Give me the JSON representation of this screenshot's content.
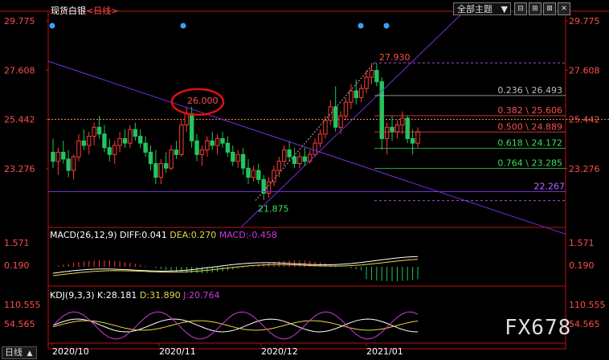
{
  "header": {
    "title": "现货白银",
    "period_label": "<日线>",
    "theme_label": "全部主题",
    "theme_arrow": "▼"
  },
  "toolbar": {
    "btn1": "⊟",
    "btn2": "⊞",
    "btn3": "⊠",
    "btn4": "✕"
  },
  "period_button": {
    "label": "日线",
    "arrow": "▲"
  },
  "watermark": "FX678",
  "macd": {
    "label": "MACD(26,12,9)",
    "diff": "DIFF:0.041",
    "dea": "DEA:0.270",
    "macd": "MACD:-0.458"
  },
  "kdj": {
    "label": "KDJ(9,3,3)",
    "k": "K:28.181",
    "d": "D:31.890",
    "j": "J:20.764"
  },
  "colors": {
    "up": "#ff3b3b",
    "down": "#22c55e",
    "axis": "#c01010",
    "trend": "#7b2cd6",
    "fib": "#9a9a9a",
    "dash_ref": "#ff6060"
  },
  "chart_data": [
    {
      "type": "candlestick",
      "title": "现货白银 <日线>",
      "y_ticks": [
        "29.775",
        "27.608",
        "25.442",
        "23.276"
      ],
      "ylim": [
        20.8,
        30.2
      ],
      "x_ticks": [
        "2020/10",
        "2020/11",
        "2020/12",
        "2021/01"
      ],
      "annotations": {
        "high_1": "26.000",
        "low": "21.875",
        "high_2": "27.930",
        "trendline_label": "22.267"
      },
      "fibonacci": [
        {
          "ratio": "0.236",
          "value": "26.493",
          "label": "0.236 \\ 26.493"
        },
        {
          "ratio": "0.382",
          "value": "25.606",
          "label": "0.382 \\ 25.606"
        },
        {
          "ratio": "0.500",
          "value": "24.889",
          "label": "0.500 \\ 24.889"
        },
        {
          "ratio": "0.618",
          "value": "24.172",
          "label": "0.618 \\ 24.172"
        },
        {
          "ratio": "0.764",
          "value": "23.285",
          "label": "0.764 \\ 23.285"
        }
      ],
      "ohlc": [
        [
          24.0,
          24.6,
          23.3,
          23.6
        ],
        [
          23.6,
          24.2,
          23.0,
          24.0
        ],
        [
          24.0,
          24.5,
          23.5,
          23.7
        ],
        [
          23.7,
          24.1,
          22.9,
          23.2
        ],
        [
          23.2,
          23.9,
          22.8,
          23.8
        ],
        [
          23.8,
          24.8,
          23.6,
          24.5
        ],
        [
          24.5,
          25.0,
          24.1,
          24.3
        ],
        [
          24.3,
          24.9,
          23.9,
          24.7
        ],
        [
          24.7,
          25.3,
          24.3,
          25.1
        ],
        [
          25.1,
          25.6,
          24.6,
          24.8
        ],
        [
          24.8,
          25.2,
          24.0,
          24.2
        ],
        [
          24.2,
          24.6,
          23.6,
          23.9
        ],
        [
          23.9,
          24.5,
          23.5,
          24.3
        ],
        [
          24.3,
          24.9,
          24.0,
          24.6
        ],
        [
          24.6,
          25.0,
          24.2,
          24.4
        ],
        [
          24.4,
          25.2,
          24.2,
          25.0
        ],
        [
          25.0,
          25.3,
          24.5,
          24.7
        ],
        [
          24.7,
          25.0,
          24.2,
          24.4
        ],
        [
          24.4,
          24.7,
          23.8,
          24.0
        ],
        [
          24.0,
          24.3,
          23.2,
          23.5
        ],
        [
          23.5,
          24.1,
          22.6,
          22.9
        ],
        [
          22.9,
          23.7,
          22.6,
          23.5
        ],
        [
          23.5,
          24.0,
          23.1,
          23.3
        ],
        [
          23.3,
          24.3,
          23.2,
          24.1
        ],
        [
          24.1,
          24.5,
          23.7,
          23.9
        ],
        [
          23.9,
          25.4,
          23.8,
          25.2
        ],
        [
          25.2,
          26.0,
          24.9,
          25.7
        ],
        [
          25.7,
          26.0,
          24.2,
          24.5
        ],
        [
          24.5,
          24.8,
          23.6,
          23.9
        ],
        [
          23.9,
          24.3,
          23.4,
          24.1
        ],
        [
          24.1,
          24.7,
          23.8,
          24.5
        ],
        [
          24.5,
          24.9,
          24.1,
          24.3
        ],
        [
          24.3,
          24.8,
          23.9,
          24.6
        ],
        [
          24.6,
          24.9,
          24.2,
          24.4
        ],
        [
          24.4,
          24.7,
          23.8,
          24.0
        ],
        [
          24.0,
          24.3,
          23.4,
          23.6
        ],
        [
          23.6,
          24.1,
          23.3,
          23.9
        ],
        [
          23.9,
          24.2,
          23.0,
          23.3
        ],
        [
          23.3,
          23.7,
          22.6,
          22.9
        ],
        [
          22.9,
          23.4,
          22.7,
          23.2
        ],
        [
          23.2,
          23.5,
          22.6,
          22.8
        ],
        [
          22.8,
          23.0,
          21.9,
          22.2
        ],
        [
          22.2,
          22.9,
          22.0,
          22.7
        ],
        [
          22.7,
          23.4,
          22.5,
          23.2
        ],
        [
          23.2,
          23.8,
          22.9,
          23.6
        ],
        [
          23.6,
          24.3,
          23.4,
          24.1
        ],
        [
          24.1,
          24.5,
          23.6,
          23.8
        ],
        [
          23.8,
          24.2,
          23.3,
          23.5
        ],
        [
          23.5,
          24.0,
          23.3,
          23.8
        ],
        [
          23.8,
          24.2,
          23.4,
          23.6
        ],
        [
          23.6,
          24.1,
          23.5,
          23.9
        ],
        [
          23.9,
          24.6,
          23.8,
          24.4
        ],
        [
          24.4,
          25.0,
          24.2,
          24.8
        ],
        [
          24.8,
          25.6,
          24.6,
          25.4
        ],
        [
          25.4,
          26.3,
          25.2,
          26.0
        ],
        [
          26.0,
          26.9,
          24.9,
          25.1
        ],
        [
          25.1,
          25.8,
          24.8,
          25.6
        ],
        [
          25.6,
          26.4,
          25.4,
          26.2
        ],
        [
          26.2,
          27.0,
          25.9,
          26.7
        ],
        [
          26.7,
          27.2,
          26.1,
          26.4
        ],
        [
          26.4,
          27.0,
          26.2,
          26.8
        ],
        [
          26.8,
          27.6,
          26.6,
          27.3
        ],
        [
          27.3,
          27.93,
          27.0,
          27.6
        ],
        [
          27.6,
          27.9,
          26.9,
          27.1
        ],
        [
          27.1,
          27.3,
          24.1,
          24.6
        ],
        [
          24.6,
          25.3,
          23.9,
          25.1
        ],
        [
          25.1,
          25.6,
          24.5,
          24.9
        ],
        [
          24.9,
          25.4,
          24.6,
          25.2
        ],
        [
          25.2,
          25.8,
          24.8,
          25.5
        ],
        [
          25.5,
          25.6,
          24.4,
          24.6
        ],
        [
          24.6,
          25.0,
          23.9,
          24.4
        ],
        [
          24.4,
          25.1,
          24.2,
          24.9
        ]
      ]
    }
  ]
}
